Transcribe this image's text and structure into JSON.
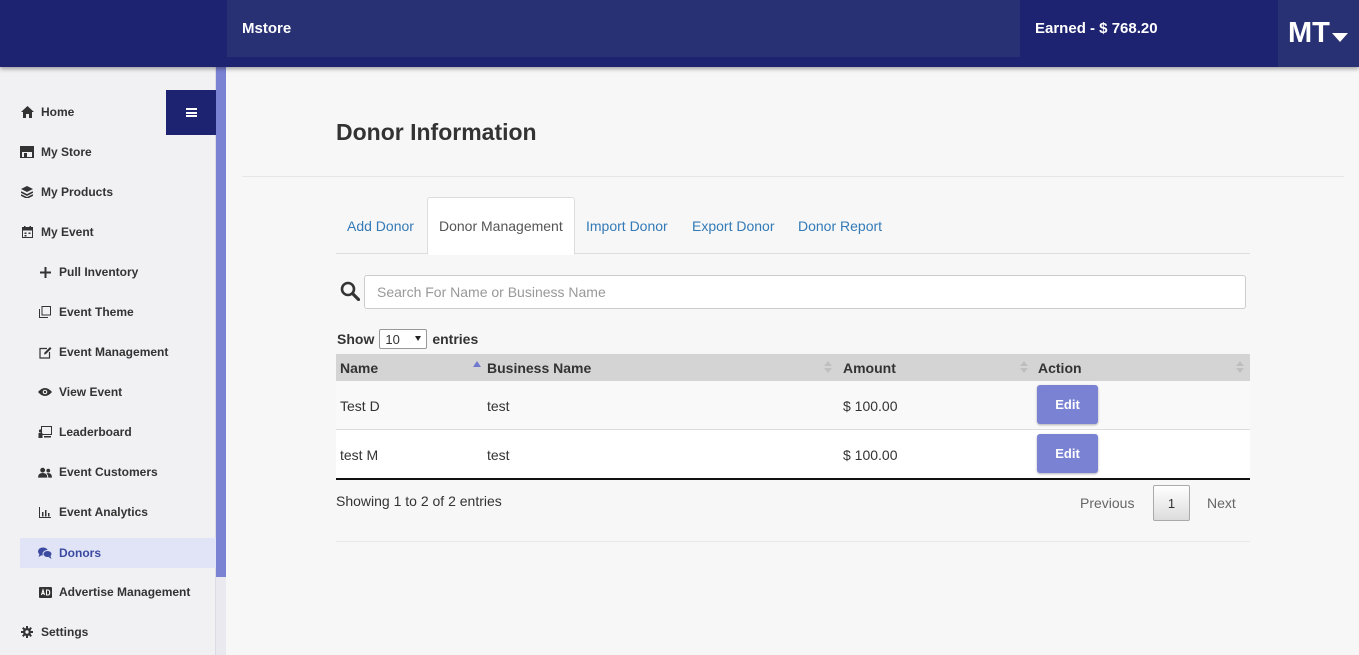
{
  "topbar": {
    "brand": "Mstore",
    "earned": "Earned - $ 768.20",
    "avatar_initials": "MT"
  },
  "sidebar": {
    "items": [
      {
        "label": "Home",
        "icon": "home-icon"
      },
      {
        "label": "My Store",
        "icon": "store-icon"
      },
      {
        "label": "My Products",
        "icon": "layers-icon"
      },
      {
        "label": "My Event",
        "icon": "calendar-icon"
      },
      {
        "label": "Pull Inventory",
        "icon": "plus-icon"
      },
      {
        "label": "Event Theme",
        "icon": "copy-icon"
      },
      {
        "label": "Event Management",
        "icon": "edit-icon"
      },
      {
        "label": "View Event",
        "icon": "eye-icon"
      },
      {
        "label": "Leaderboard",
        "icon": "chalkboard-icon"
      },
      {
        "label": "Event Customers",
        "icon": "users-icon"
      },
      {
        "label": "Event Analytics",
        "icon": "bar-chart-icon"
      },
      {
        "label": "Donors",
        "icon": "comments-icon",
        "active": true
      },
      {
        "label": "Advertise Management",
        "icon": "ad-icon"
      },
      {
        "label": "Settings",
        "icon": "gear-icon"
      }
    ]
  },
  "main": {
    "title": "Donor Information",
    "tabs": [
      {
        "label": "Add Donor"
      },
      {
        "label": "Donor Management",
        "active": true
      },
      {
        "label": "Import Donor"
      },
      {
        "label": "Export Donor"
      },
      {
        "label": "Donor Report"
      }
    ],
    "search": {
      "placeholder": "Search For Name or Business Name",
      "value": ""
    },
    "length": {
      "show": "Show",
      "value": "10",
      "entries": "entries"
    },
    "table": {
      "columns": [
        "Name",
        "Business Name",
        "Amount",
        "Action"
      ],
      "rows": [
        {
          "name": "Test D",
          "business": "test",
          "amount": "$ 100.00",
          "action": "Edit"
        },
        {
          "name": "test M",
          "business": "test",
          "amount": "$ 100.00",
          "action": "Edit"
        }
      ]
    },
    "info": "Showing 1 to 2 of 2 entries",
    "pagination": {
      "previous": "Previous",
      "page": "1",
      "next": "Next"
    }
  },
  "colors": {
    "topbar": "#1d2370",
    "brand_strip": "#283174",
    "accent": "#7a82d4",
    "link": "#337ab7"
  }
}
